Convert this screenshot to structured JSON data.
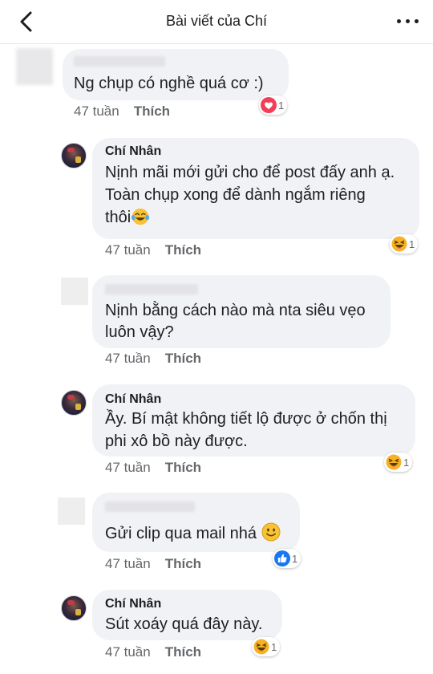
{
  "header": {
    "title": "Bài viết của Chí"
  },
  "comments": [
    {
      "text": "Ng chụp có nghề quá cơ :)",
      "time": "47 tuần",
      "like": "Thích",
      "reaction_icon": "heart-icon",
      "reaction_count": "1"
    },
    {
      "author": "Chí Nhân",
      "line1": "Nịnh mãi mới gửi cho để post đấy anh ạ.",
      "line2": "Toàn chụp xong để dành ngắm riêng",
      "line3": "thôi",
      "time": "47 tuần",
      "like": "Thích",
      "reaction_icon": "laugh-icon",
      "reaction_count": "1"
    },
    {
      "line1": "Nịnh bằng cách nào mà nta siêu vẹo",
      "line2": "luôn vậy?",
      "time": "47 tuần",
      "like": "Thích"
    },
    {
      "author": "Chí Nhân",
      "line1": "Ầy. Bí mật không tiết lộ được ở chốn thị",
      "line2": "phi xô bồ này được.",
      "time": "47 tuần",
      "like": "Thích",
      "reaction_icon": "laugh-icon",
      "reaction_count": "1"
    },
    {
      "text": "Gửi clip qua mail nhá",
      "time": "47 tuần",
      "like": "Thích",
      "reaction_icon": "thumbs-up-icon",
      "reaction_count": "1"
    },
    {
      "author": "Chí Nhân",
      "text": "Sút xoáy quá đây này.",
      "time": "47 tuần",
      "like": "Thích",
      "reaction_icon": "laugh-icon",
      "reaction_count": "1"
    }
  ],
  "colors": {
    "bubble": "#f0f2f5",
    "meta": "#65676b",
    "like_reaction": "#1877f2",
    "love_reaction": "#f33e58",
    "haha_reaction": "#f7b125"
  }
}
